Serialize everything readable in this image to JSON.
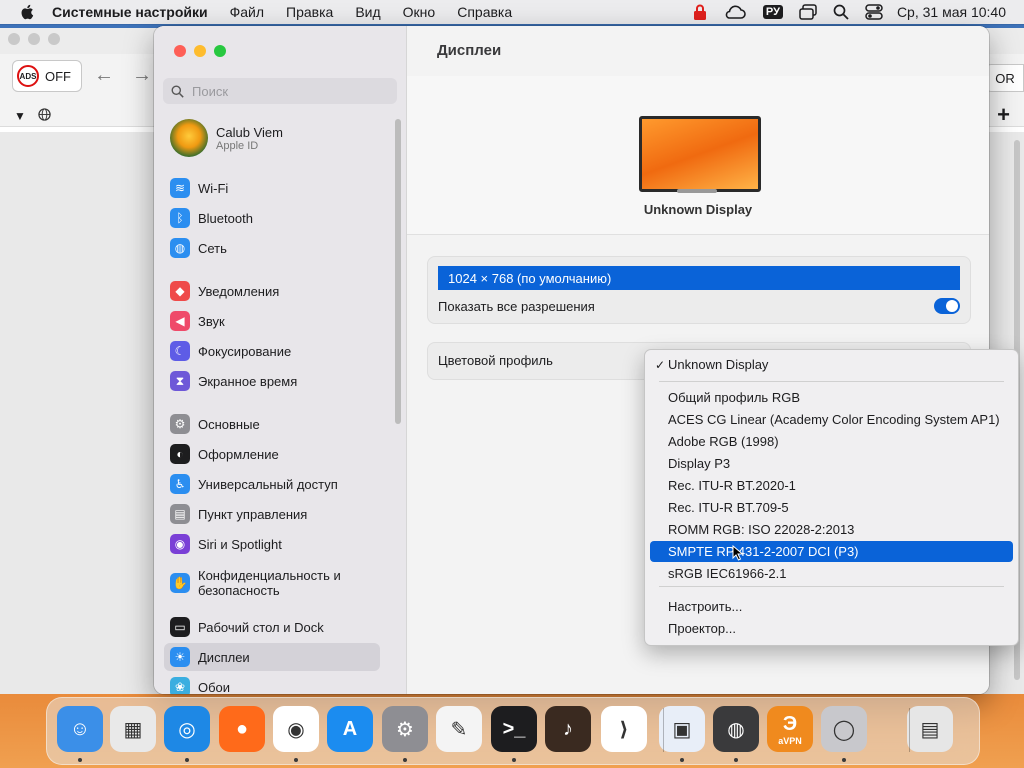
{
  "menubar": {
    "app_name": "Системные настройки",
    "items": [
      "Файл",
      "Правка",
      "Вид",
      "Окно",
      "Справка"
    ],
    "lang": "РУ",
    "clock": "Ср, 31 мая  10:40"
  },
  "bg_browser": {
    "ads_label": "ADS",
    "ads_state": "OFF",
    "right_button": "OR"
  },
  "sidebar": {
    "search_placeholder": "Поиск",
    "user": {
      "name": "Calub Viem",
      "subtitle": "Apple ID"
    },
    "items": [
      {
        "label": "Wi-Fi",
        "icon": "wifi-icon",
        "color": "#2b8ef0"
      },
      {
        "label": "Bluetooth",
        "icon": "bluetooth-icon",
        "color": "#2b8ef0"
      },
      {
        "label": "Сеть",
        "icon": "globe-icon",
        "color": "#2b8ef0"
      },
      {
        "label": "Уведомления",
        "icon": "bell-icon",
        "color": "#ef4a4a"
      },
      {
        "label": "Звук",
        "icon": "speaker-icon",
        "color": "#ef4a6a"
      },
      {
        "label": "Фокусирование",
        "icon": "moon-icon",
        "color": "#5e5ce6"
      },
      {
        "label": "Экранное время",
        "icon": "hourglass-icon",
        "color": "#6e58d8"
      },
      {
        "label": "Основные",
        "icon": "gear-icon",
        "color": "#8e8e93"
      },
      {
        "label": "Оформление",
        "icon": "appearance-icon",
        "color": "#1d1d1f"
      },
      {
        "label": "Универсальный доступ",
        "icon": "accessibility-icon",
        "color": "#2b8ef0"
      },
      {
        "label": "Пункт управления",
        "icon": "control-center-icon",
        "color": "#8e8e93"
      },
      {
        "label": "Siri и Spotlight",
        "icon": "siri-icon",
        "color": "#7a3fd6"
      },
      {
        "label": "Конфиденциальность и безопасность",
        "icon": "hand-icon",
        "color": "#2b8ef0"
      },
      {
        "label": "Рабочий стол и Dock",
        "icon": "dock-icon",
        "color": "#1d1d1f"
      },
      {
        "label": "Дисплеи",
        "icon": "sun-icon",
        "color": "#2b8ef0"
      },
      {
        "label": "Обои",
        "icon": "wallpaper-icon",
        "color": "#3aaee0"
      }
    ],
    "selected_index": 14
  },
  "main": {
    "title": "Дисплеи",
    "display_name": "Unknown Display",
    "resolution_selected": "1024 × 768 (по умолчанию)",
    "show_all_label": "Показать все разрешения",
    "show_all_on": true,
    "color_profile_label": "Цветовой профиль"
  },
  "popup": {
    "checked": "Unknown Display",
    "options": [
      "Общий профиль RGB",
      "ACES CG Linear (Academy Color Encoding System AP1)",
      "Adobe RGB (1998)",
      "Display P3",
      "Rec. ITU-R BT.2020-1",
      "Rec. ITU-R BT.709-5",
      "ROMM RGB: ISO 22028-2:2013",
      "SMPTE RP 431-2-2007 DCI (P3)",
      "sRGB IEC61966-2.1"
    ],
    "highlighted_index": 7,
    "actions": [
      "Настроить...",
      "Проектор..."
    ]
  },
  "dock": {
    "apps": [
      {
        "name": "finder-icon",
        "color": "#3b8fe8",
        "glyph": "☺"
      },
      {
        "name": "launchpad-icon",
        "color": "#e9e9e9",
        "glyph": "▦"
      },
      {
        "name": "safari-icon",
        "color": "#1e88e5",
        "glyph": "◎"
      },
      {
        "name": "firefox-icon",
        "color": "#ff6a1a",
        "glyph": "●"
      },
      {
        "name": "chrome-icon",
        "color": "#ffffff",
        "glyph": "◉"
      },
      {
        "name": "app-store-icon",
        "color": "#1b8cf0",
        "glyph": "A"
      },
      {
        "name": "system-settings-icon",
        "color": "#8e8e93",
        "glyph": "⚙"
      },
      {
        "name": "textedit-icon",
        "color": "#f4f4f4",
        "glyph": "✎"
      },
      {
        "name": "terminal-icon",
        "color": "#1d1d1f",
        "glyph": ">_"
      },
      {
        "name": "garageband-icon",
        "color": "#3a2a20",
        "glyph": "♪"
      },
      {
        "name": "vscode-icon",
        "color": "#ffffff",
        "glyph": "⟩"
      },
      {
        "name": "screen-sharing-icon",
        "color": "#e8eef8",
        "glyph": "▣"
      },
      {
        "name": "network-icon",
        "color": "#3a3a3c",
        "glyph": "◍"
      },
      {
        "name": "vpn-icon",
        "color": "#f08a1e",
        "glyph": "Э"
      },
      {
        "name": "installer-icon",
        "color": "#c8c8cc",
        "glyph": "◯"
      },
      {
        "name": "trash-icon",
        "color": "#e6e6e6",
        "glyph": "▤"
      }
    ],
    "vpn_label": "aVPN"
  }
}
